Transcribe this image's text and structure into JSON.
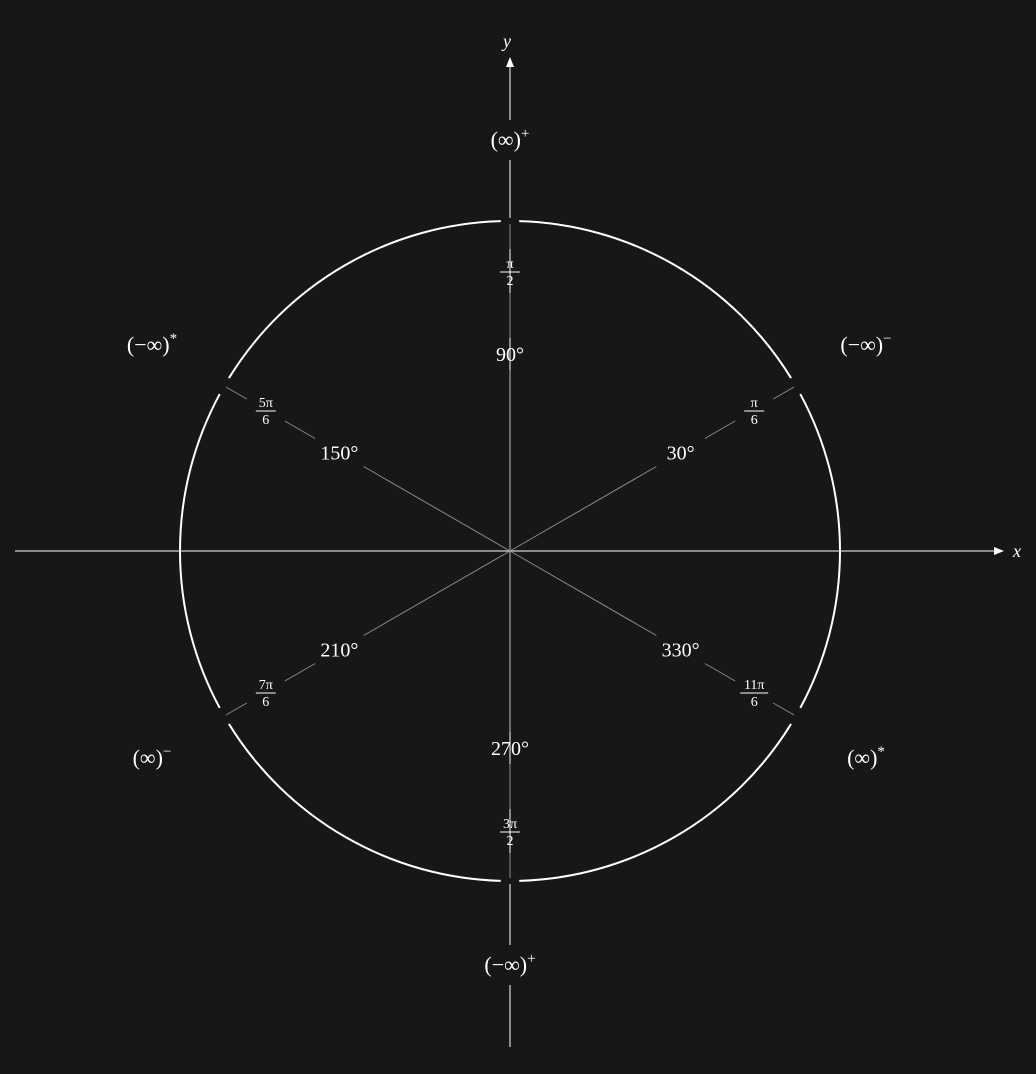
{
  "axes": {
    "x_label": "x",
    "y_label": "y"
  },
  "spokes": [
    {
      "id": "30",
      "degree_label": "30°",
      "rad_num": "π",
      "rad_den": "6",
      "angle_deg": 30
    },
    {
      "id": "90",
      "degree_label": "90°",
      "rad_num": "π",
      "rad_den": "2",
      "angle_deg": 90
    },
    {
      "id": "150",
      "degree_label": "150°",
      "rad_num": "5π",
      "rad_den": "6",
      "angle_deg": 150
    },
    {
      "id": "210",
      "degree_label": "210°",
      "rad_num": "7π",
      "rad_den": "6",
      "angle_deg": 210
    },
    {
      "id": "270",
      "degree_label": "270°",
      "rad_num": "3π",
      "rad_den": "2",
      "angle_deg": 270
    },
    {
      "id": "330",
      "degree_label": "330°",
      "rad_num": "11π",
      "rad_den": "6",
      "angle_deg": 330
    }
  ],
  "infinities": {
    "top": {
      "base": "(∞)",
      "sup": "+",
      "color": "#e01818"
    },
    "bottom": {
      "base": "(−∞)",
      "sup": "+",
      "color": "#3fb6d8"
    },
    "upper_left": {
      "base": "(−∞)",
      "sup": "*",
      "color": "#f0e020"
    },
    "upper_right": {
      "base": "(−∞)",
      "sup": "−",
      "color": "#f4b6b6"
    },
    "lower_left": {
      "base": "(∞)",
      "sup": "−",
      "color": "#28d828"
    },
    "lower_right": {
      "base": "(∞)",
      "sup": "*",
      "color": "#3a86ea"
    }
  },
  "colors": {
    "background": "#171717",
    "circle": "#ffffff",
    "axis": "#ffffff",
    "spoke": "#8a8a8a"
  }
}
